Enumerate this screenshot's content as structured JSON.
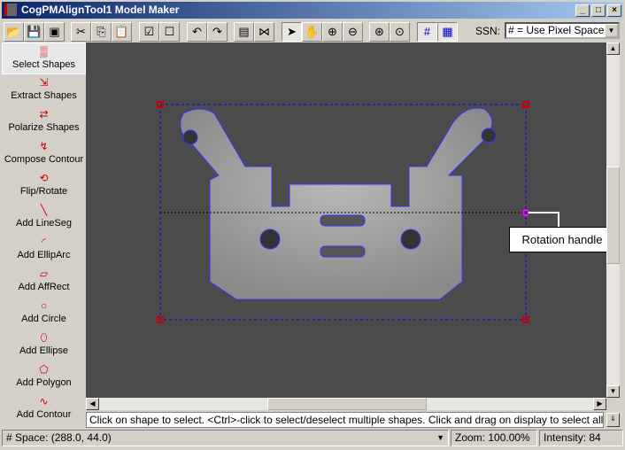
{
  "window": {
    "title": "CogPMAlignTool1 Model Maker",
    "min": "_",
    "max": "□",
    "close": "×"
  },
  "toolbar": {
    "tools": [
      {
        "name": "open-icon",
        "glyph": "📂"
      },
      {
        "name": "save-icon",
        "glyph": "💾"
      },
      {
        "name": "save-as-icon",
        "glyph": "▣"
      },
      {
        "name": "cut-icon",
        "glyph": "✂"
      },
      {
        "name": "copy-icon",
        "glyph": "⎘"
      },
      {
        "name": "paste-icon",
        "glyph": "📋"
      },
      {
        "name": "select-all-icon",
        "glyph": "☑"
      },
      {
        "name": "deselect-icon",
        "glyph": "☐"
      },
      {
        "name": "undo-icon",
        "glyph": "↶"
      },
      {
        "name": "redo-icon",
        "glyph": "↷"
      },
      {
        "name": "properties-icon",
        "glyph": "▤"
      },
      {
        "name": "fit-icon",
        "glyph": "⋈"
      },
      {
        "name": "pointer-icon",
        "glyph": "➤"
      },
      {
        "name": "pan-icon",
        "glyph": "✋"
      },
      {
        "name": "zoom-in-icon",
        "glyph": "⊕"
      },
      {
        "name": "zoom-out-icon",
        "glyph": "⊖"
      },
      {
        "name": "zoom-fit-icon",
        "glyph": "⊛"
      },
      {
        "name": "zoom-100-icon",
        "glyph": "⊙"
      },
      {
        "name": "grid-icon",
        "glyph": "#"
      },
      {
        "name": "fine-grid-icon",
        "glyph": "▦"
      }
    ],
    "ssn_label": "SSN:",
    "ssn_value": "# = Use Pixel Space"
  },
  "sidebar": {
    "items": [
      {
        "label": "Select Shapes",
        "glyph": "▒"
      },
      {
        "label": "Extract Shapes",
        "glyph": "⇲"
      },
      {
        "label": "Polarize Shapes",
        "glyph": "⇄"
      },
      {
        "label": "Compose Contour",
        "glyph": "↯"
      },
      {
        "label": "Flip/Rotate",
        "glyph": "⟲"
      },
      {
        "label": "Add LineSeg",
        "glyph": "╲"
      },
      {
        "label": "Add EllipArc",
        "glyph": "◜"
      },
      {
        "label": "Add AffRect",
        "glyph": "▱"
      },
      {
        "label": "Add Circle",
        "glyph": "○"
      },
      {
        "label": "Add Ellipse",
        "glyph": "⬯"
      },
      {
        "label": "Add Polygon",
        "glyph": "⬠"
      },
      {
        "label": "Add Contour",
        "glyph": "∿"
      }
    ]
  },
  "canvas": {
    "callout": "Rotation handle",
    "selection_color": "#0000ff",
    "handle_color": "#c00000",
    "rotation_handle_color": "#ff00ff"
  },
  "hint": "Click on shape to select. <Ctrl>-click to select/deselect multiple shapes. Click and drag on display to select all shapes",
  "status": {
    "space": "# Space:  (288.0, 44.0)",
    "zoom": "Zoom:  100.00%",
    "intensity": "Intensity: 84"
  }
}
